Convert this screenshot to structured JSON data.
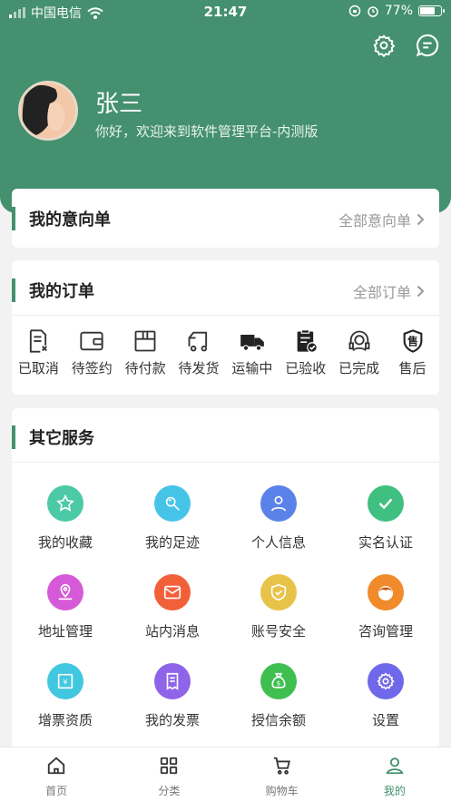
{
  "status_bar": {
    "carrier": "中国电信",
    "time": "21:47",
    "battery": "77%",
    "battery_level": 0.77
  },
  "user": {
    "name": "张三",
    "welcome": "你好，欢迎来到软件管理平台-内测版"
  },
  "intent_section": {
    "title": "我的意向单",
    "link": "全部意向单"
  },
  "orders_section": {
    "title": "我的订单",
    "link": "全部订单",
    "items": [
      {
        "label": "已取消",
        "icon": "cancelled-order-icon"
      },
      {
        "label": "待签约",
        "icon": "wallet-icon"
      },
      {
        "label": "待付款",
        "icon": "box-icon"
      },
      {
        "label": "待发货",
        "icon": "cart-truck-icon"
      },
      {
        "label": "运输中",
        "icon": "truck-icon"
      },
      {
        "label": "已验收",
        "icon": "clipboard-check-icon"
      },
      {
        "label": "已完成",
        "icon": "headset-icon"
      },
      {
        "label": "售后",
        "icon": "shield-sale-icon"
      }
    ]
  },
  "services_section": {
    "title": "其它服务",
    "items": [
      {
        "label": "我的收藏",
        "icon": "star-icon",
        "color": "#4cc9a6"
      },
      {
        "label": "我的足迹",
        "icon": "footprint-icon",
        "color": "#46c4e8"
      },
      {
        "label": "个人信息",
        "icon": "person-icon",
        "color": "#5b82e8"
      },
      {
        "label": "实名认证",
        "icon": "check-icon",
        "color": "#3fbf80"
      },
      {
        "label": "地址管理",
        "icon": "location-icon",
        "color": "#d65ad8"
      },
      {
        "label": "站内消息",
        "icon": "mail-icon",
        "color": "#f2603a"
      },
      {
        "label": "账号安全",
        "icon": "shield-icon",
        "color": "#e8c34a"
      },
      {
        "label": "咨询管理",
        "icon": "consult-icon",
        "color": "#f08a2a"
      },
      {
        "label": "增票资质",
        "icon": "ticket-icon",
        "color": "#42c7e0"
      },
      {
        "label": "我的发票",
        "icon": "invoice-icon",
        "color": "#8e64e8"
      },
      {
        "label": "授信余额",
        "icon": "money-bag-icon",
        "color": "#3fbf50"
      },
      {
        "label": "设置",
        "icon": "settings-icon",
        "color": "#7068ea"
      }
    ]
  },
  "tab_bar": {
    "tabs": [
      {
        "label": "首页",
        "icon": "home-icon"
      },
      {
        "label": "分类",
        "icon": "grid-icon"
      },
      {
        "label": "购物车",
        "icon": "cart-icon"
      },
      {
        "label": "我的",
        "icon": "profile-icon",
        "active": true
      }
    ]
  },
  "colors": {
    "primary": "#44906f",
    "background": "#f2f2f2"
  }
}
